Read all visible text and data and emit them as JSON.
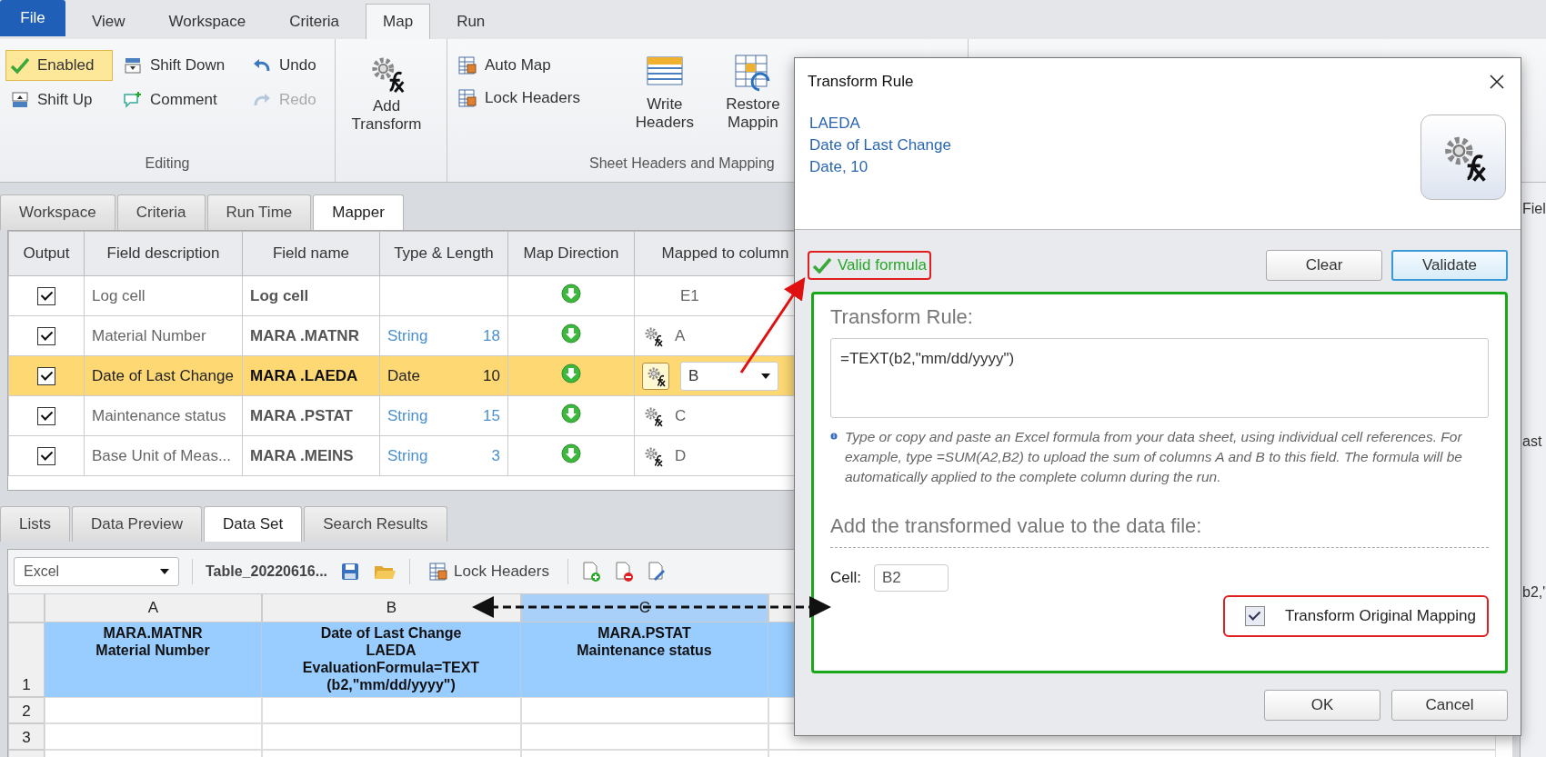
{
  "ribbon": {
    "file_button": "File",
    "tabs": [
      {
        "label": "View",
        "selected": false
      },
      {
        "label": "Workspace",
        "selected": false
      },
      {
        "label": "Criteria",
        "selected": false
      },
      {
        "label": "Map",
        "selected": true
      },
      {
        "label": "Run",
        "selected": false
      }
    ],
    "editing": {
      "label": "Editing",
      "items": [
        {
          "label": "Enabled",
          "on": true,
          "disabled": false
        },
        {
          "label": "Shift Down",
          "on": false,
          "disabled": false
        },
        {
          "label": "Undo",
          "on": false,
          "disabled": false
        },
        {
          "label": "Shift Up",
          "on": false,
          "disabled": false
        },
        {
          "label": "Comment",
          "on": false,
          "disabled": false
        },
        {
          "label": "Redo",
          "on": false,
          "disabled": true
        }
      ]
    },
    "transform": {
      "label": "Add Transform"
    },
    "sheet": {
      "label": "Sheet Headers and Mapping",
      "small": [
        "Auto Map",
        "Lock Headers"
      ],
      "large": [
        "Write Headers",
        "Restore Mappin"
      ]
    }
  },
  "mapper_tabs": [
    {
      "label": "Workspace",
      "selected": false
    },
    {
      "label": "Criteria",
      "selected": false
    },
    {
      "label": "Run Time",
      "selected": false
    },
    {
      "label": "Mapper",
      "selected": true
    }
  ],
  "mapper": {
    "columns": [
      "Output",
      "Field description",
      "Field name",
      "Type & Length",
      "Map Direction",
      "Mapped to column"
    ],
    "rows": [
      {
        "output": true,
        "description": "Log cell",
        "name": "Log cell",
        "type": "",
        "length": "",
        "transform_icon": false,
        "mapped": "E1",
        "selected": false
      },
      {
        "output": true,
        "description": "Material Number",
        "name": "MARA .MATNR",
        "type": "String",
        "length": "18",
        "transform_icon": true,
        "mapped": "A",
        "selected": false
      },
      {
        "output": true,
        "description": "Date of Last Change",
        "name": "MARA .LAEDA",
        "type": "Date",
        "length": "10",
        "transform_icon": true,
        "mapped": "B",
        "selected": true
      },
      {
        "output": true,
        "description": "Maintenance status",
        "name": "MARA .PSTAT",
        "type": "String",
        "length": "15",
        "transform_icon": true,
        "mapped": "C",
        "selected": false
      },
      {
        "output": true,
        "description": "Base Unit of Meas...",
        "name": "MARA .MEINS",
        "type": "String",
        "length": "3",
        "transform_icon": true,
        "mapped": "D",
        "selected": false
      }
    ]
  },
  "data_tabs": [
    {
      "label": "Lists",
      "selected": false
    },
    {
      "label": "Data Preview",
      "selected": false
    },
    {
      "label": "Data Set",
      "selected": true
    },
    {
      "label": "Search Results",
      "selected": false
    }
  ],
  "dataset_toolbar": {
    "format": "Excel",
    "file": "Table_20220616...",
    "lock_headers": "Lock Headers"
  },
  "sheet": {
    "columns": [
      {
        "label": "A",
        "highlighted": false
      },
      {
        "label": "B",
        "highlighted": false
      },
      {
        "label": "C",
        "highlighted": true
      }
    ],
    "rows": [
      {
        "number": "1",
        "cells": [
          "MARA.MATNR\nMaterial Number",
          "Date of Last Change\nLAEDA\nEvaluationFormula=TEXT\n(b2,\"mm/dd/yyyy\")",
          "MARA.PSTAT\nMaintenance status"
        ]
      },
      {
        "number": "2",
        "cells": []
      },
      {
        "number": "3",
        "cells": []
      }
    ]
  },
  "right_panel": {
    "texts": [
      "Fiel",
      "ast",
      "b2,\""
    ]
  },
  "dialog": {
    "title": "Transform Rule",
    "field": [
      "LAEDA",
      "Date of Last Change",
      "Date, 10"
    ],
    "status": "Valid formula",
    "buttons": [
      "Clear",
      "Validate"
    ],
    "rule_label": "Transform Rule:",
    "formula": "=TEXT(b2,\"mm/dd/yyyy\")",
    "hint": "Type or copy and paste an Excel formula from your data sheet, using individual cell references. For example, type =SUM(A2,B2) to upload the sum of columns A and B to this field. The formula will be automatically applied to the complete column during the run.",
    "add_label": "Add the transformed value to the data file:",
    "cell_label": "Cell:",
    "cell": "B2",
    "transform_original": {
      "label": "Transform Original Mapping",
      "checked": true
    },
    "footer_buttons": [
      "OK",
      "Cancel"
    ]
  }
}
